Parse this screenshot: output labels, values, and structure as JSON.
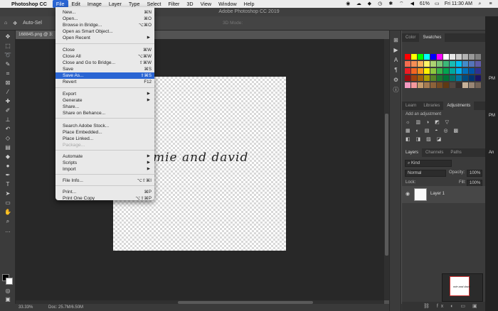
{
  "menubar": {
    "app_name": "Photoshop CC",
    "items": [
      "File",
      "Edit",
      "Image",
      "Layer",
      "Type",
      "Select",
      "Filter",
      "3D",
      "View",
      "Window",
      "Help"
    ],
    "status_battery": "61%",
    "clock": "Fri 11:30 AM"
  },
  "window_title": "Adobe Photoshop CC 2019",
  "options_bar": {
    "auto_select": "Auto-Sel",
    "mode_label": "3D Mode:"
  },
  "document": {
    "tab_label": "168845.png @ 3:",
    "script_text": "mie and david",
    "zoom": "33.33%",
    "doc_size": "Doc: 25.7M/6.50M"
  },
  "file_menu": {
    "items": [
      {
        "label": "New...",
        "shortcut": "⌘N"
      },
      {
        "label": "Open...",
        "shortcut": "⌘O"
      },
      {
        "label": "Browse in Bridge...",
        "shortcut": "⌥⌘O"
      },
      {
        "label": "Open as Smart Object...",
        "shortcut": ""
      },
      {
        "label": "Open Recent",
        "shortcut": "▶"
      },
      {
        "label": "Close",
        "shortcut": "⌘W"
      },
      {
        "label": "Close All",
        "shortcut": "⌥⌘W"
      },
      {
        "label": "Close and Go to Bridge...",
        "shortcut": "⇧⌘W"
      },
      {
        "label": "Save",
        "shortcut": "⌘S"
      },
      {
        "label": "Save As...",
        "shortcut": "⇧⌘S"
      },
      {
        "label": "Revert",
        "shortcut": "F12"
      },
      {
        "label": "Export",
        "shortcut": "▶"
      },
      {
        "label": "Generate",
        "shortcut": "▶"
      },
      {
        "label": "Share...",
        "shortcut": ""
      },
      {
        "label": "Share on Behance...",
        "shortcut": ""
      },
      {
        "label": "Search Adobe Stock...",
        "shortcut": ""
      },
      {
        "label": "Place Embedded...",
        "shortcut": ""
      },
      {
        "label": "Place Linked...",
        "shortcut": ""
      },
      {
        "label": "Package...",
        "shortcut": ""
      },
      {
        "label": "Automate",
        "shortcut": "▶"
      },
      {
        "label": "Scripts",
        "shortcut": "▶"
      },
      {
        "label": "Import",
        "shortcut": "▶"
      },
      {
        "label": "File Info...",
        "shortcut": "⌥⇧⌘I"
      },
      {
        "label": "Print...",
        "shortcut": "⌘P"
      },
      {
        "label": "Print One Copy",
        "shortcut": "⌥⇧⌘P"
      }
    ],
    "highlighted": "Save As...",
    "disabled": "Package..."
  },
  "swatches_panel": {
    "tabs": [
      "Color",
      "Swatches"
    ],
    "colors": [
      "#ff0000",
      "#ffff00",
      "#00ff00",
      "#00ffff",
      "#0000ff",
      "#ff00ff",
      "#ffffff",
      "#e6e6e6",
      "#cccccc",
      "#b3b3b3",
      "#999999",
      "#808080",
      "#f26c4f",
      "#f68e55",
      "#fbaf5c",
      "#fff467",
      "#acd372",
      "#7cc576",
      "#3bb878",
      "#1abbb4",
      "#00bff3",
      "#438ccb",
      "#5574b9",
      "#605ca8",
      "#ed1c24",
      "#f26522",
      "#f7941d",
      "#fff200",
      "#8dc73f",
      "#39b54a",
      "#00a651",
      "#00a99d",
      "#00aeef",
      "#0072bc",
      "#0054a6",
      "#2e3192",
      "#9e0b0f",
      "#a0410d",
      "#a3620a",
      "#aba000",
      "#598527",
      "#1a7b30",
      "#007236",
      "#00746b",
      "#0076a3",
      "#004b80",
      "#003471",
      "#1b1464",
      "#f49ac1",
      "#f5989d",
      "#c69c6d",
      "#a67c52",
      "#8c6239",
      "#754c24",
      "#603913",
      "#534741",
      "#362f2d",
      "#c7b299",
      "#998675",
      "#736357"
    ]
  },
  "adjustments_panel": {
    "tabs": [
      "Learn",
      "Libraries",
      "Adjustments"
    ],
    "hint": "Add an adjustment",
    "icons_row1": "☼ ▥ ◑ ◩ ▽",
    "icons_row2": "▦ ◐ ▤ ◓ ◎ ▩",
    "icons_row3": "◧ ◨ ▨ ◪"
  },
  "layers_panel": {
    "tabs": [
      "Layers",
      "Channels",
      "Paths"
    ],
    "filter": "Kind",
    "blend_mode": "Normal",
    "opacity_label": "Opacity:",
    "opacity_value": "100%",
    "lock_label": "Lock:",
    "fill_label": "Fill:",
    "fill_value": "100%",
    "layer_name": "Layer 1",
    "footer_icons": "⛓ fx ◐ ▭ ▣ 🗑"
  },
  "edge_labels": [
    "PM",
    "PM",
    "An"
  ]
}
